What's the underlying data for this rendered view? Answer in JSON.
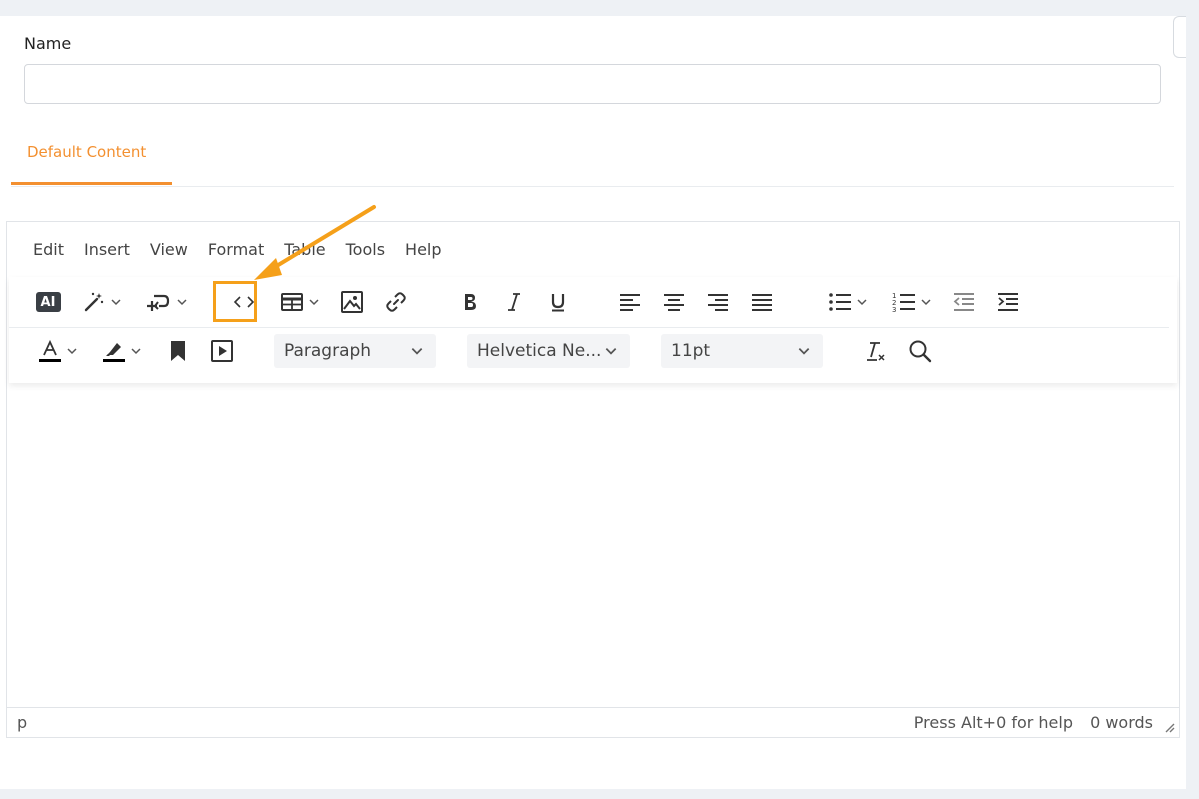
{
  "form": {
    "name_label": "Name",
    "name_value": "",
    "name_placeholder": ""
  },
  "tabs": [
    {
      "label": "Default Content",
      "active": true
    }
  ],
  "editor": {
    "menu": [
      "Edit",
      "Insert",
      "View",
      "Format",
      "Table",
      "Tools",
      "Help"
    ],
    "toolbar_row1": [
      "ai-icon",
      "magic-wand-icon",
      "insert-template-icon",
      "source-code-icon",
      "table-icon",
      "image-icon",
      "link-icon",
      "bold-icon",
      "italic-icon",
      "underline-icon",
      "align-left-icon",
      "align-center-icon",
      "align-right-icon",
      "align-justify-icon",
      "bullet-list-icon",
      "numbered-list-icon",
      "outdent-icon",
      "indent-icon"
    ],
    "toolbar_row2": [
      "text-color-icon",
      "highlight-color-icon",
      "bookmark-icon",
      "media-icon",
      "clear-formatting-icon",
      "search-icon"
    ],
    "ai_label": "AI",
    "block_format": "Paragraph",
    "font_family": "Helvetica Ne...",
    "font_size": "11pt",
    "status_path": "p",
    "status_help": "Press Alt+0 for help",
    "word_count": "0 words"
  },
  "colors": {
    "accent": "#f39030",
    "annotation": "#f5a01a",
    "text_color_swatch": "#000000",
    "highlight_swatch": "#000000"
  }
}
